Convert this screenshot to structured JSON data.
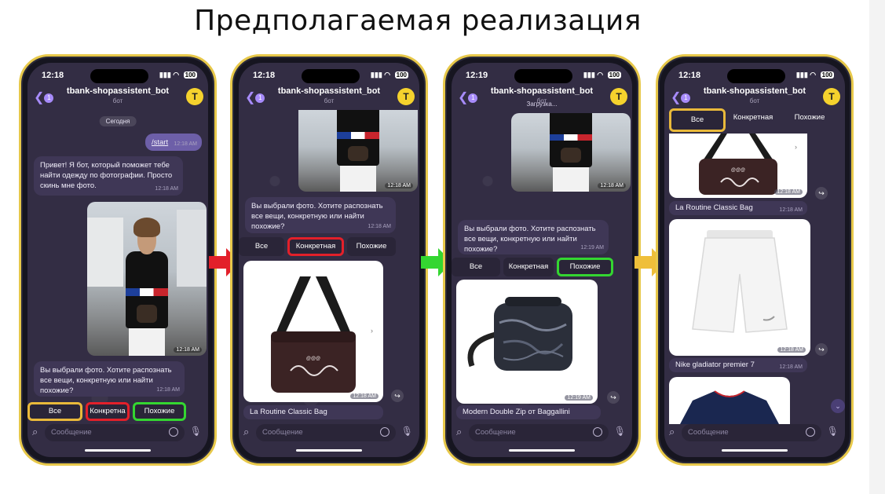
{
  "title": "Предполагаемая реализация",
  "common": {
    "bot_name": "tbank-shopassistent_bot",
    "bot_subtitle": "бот",
    "avatar_letter": "T",
    "back_count": "1",
    "input_placeholder": "Сообщение",
    "battery": "100"
  },
  "phone1": {
    "time": "12:18",
    "date_pill": "Сегодня",
    "start_cmd": "/start",
    "start_time": "12:18 AM",
    "greeting": "Привет! Я бот, который поможет тебе найти одежду по фотографии. Просто скинь мне фото.",
    "greeting_time": "12:18 AM",
    "photo_time": "12:18 AM",
    "question": "Вы выбрали фото. Хотите распознать все вещи, конкретную или найти похожие?",
    "question_time": "12:18 AM",
    "buttons": [
      "Все",
      "Конкретна",
      "Похожие"
    ]
  },
  "phone2": {
    "time": "12:18",
    "photo_time": "12:18 AM",
    "question": "Вы выбрали фото. Хотите распознать все вещи, конкретную или найти похожие?",
    "question_time": "12:18 AM",
    "buttons": [
      "Все",
      "Конкретная",
      "Похожие"
    ],
    "product_time": "12:18 AM",
    "product_caption": "La Routine Classic Bag"
  },
  "phone3": {
    "time": "12:19",
    "loading": "Загрузка...",
    "photo_time": "12:18 AM",
    "question": "Вы выбрали фото. Хотите распознать все вещи, конкретную или найти похожие?",
    "question_time": "12:19 AM",
    "buttons": [
      "Все",
      "Конкретная",
      "Похожие"
    ],
    "product_time": "12:19 AM",
    "product_caption": "Modern Double Zip от Baggallini"
  },
  "phone4": {
    "time": "12:18",
    "buttons": [
      "Все",
      "Конкретная",
      "Похожие"
    ],
    "product1_time": "12:18 AM",
    "product1_caption": "La Routine Classic Bag",
    "product1_caption_time": "12:18 AM",
    "product2_time": "12:18 AM",
    "product2_caption": "Nike gladiator premier 7",
    "product2_caption_time": "12:18 AM"
  },
  "colors": {
    "highlight_yellow": "#e9b93a",
    "highlight_red": "#e3202a",
    "highlight_green": "#34d631",
    "arrow_red": "#e3202a",
    "arrow_green": "#34d631",
    "arrow_yellow": "#efbf3a"
  }
}
